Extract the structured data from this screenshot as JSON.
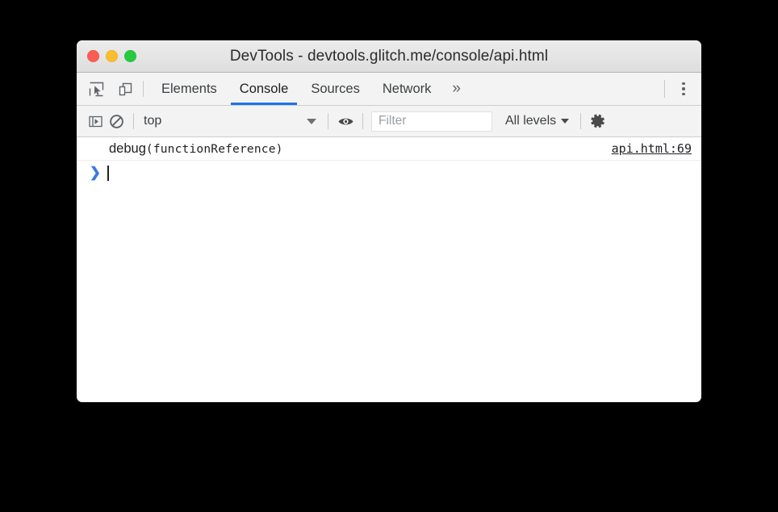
{
  "window": {
    "title": "DevTools - devtools.glitch.me/console/api.html",
    "traffic_lights": [
      {
        "name": "close",
        "color": "#fb5c54"
      },
      {
        "name": "minimize",
        "color": "#fcbc2f"
      },
      {
        "name": "maximize",
        "color": "#26c93f"
      }
    ]
  },
  "tabbar": {
    "inspect_icon": "inspect-element-icon",
    "device_icon": "device-toolbar-icon",
    "tabs": [
      {
        "label": "Elements",
        "active": false
      },
      {
        "label": "Console",
        "active": true
      },
      {
        "label": "Sources",
        "active": false
      },
      {
        "label": "Network",
        "active": false
      }
    ],
    "more_tabs_label": "»",
    "menu_icon": "more-options-icon",
    "active_underline_color": "#1a73e8"
  },
  "console_toolbar": {
    "sidebar_toggle_icon": "console-sidebar-toggle-icon",
    "clear_icon": "clear-console-icon",
    "context": {
      "value": "top"
    },
    "eye_icon": "live-expression-eye-icon",
    "filter": {
      "value": "",
      "placeholder": "Filter"
    },
    "level": {
      "value": "All levels"
    },
    "settings_icon": "settings-gear-icon"
  },
  "console_body": {
    "messages": [
      {
        "text_plain": "debug",
        "text_mono": "(functionReference)",
        "source": "api.html:69"
      }
    ],
    "prompt": {
      "chevron": "❯",
      "input_value": ""
    }
  }
}
